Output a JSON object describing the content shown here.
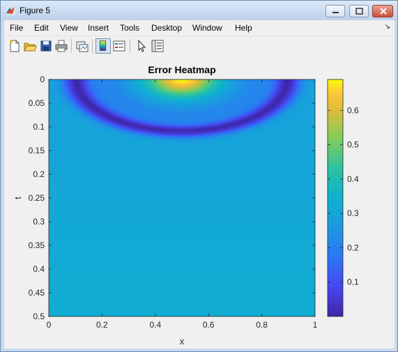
{
  "window": {
    "title": "Figure 5"
  },
  "menu": [
    "File",
    "Edit",
    "View",
    "Insert",
    "Tools",
    "Desktop",
    "Window",
    "Help"
  ],
  "toolbar_icons": [
    "new-figure-icon",
    "open-icon",
    "save-icon",
    "print-icon",
    "link-plot-icon",
    "colorbar-icon",
    "legend-icon",
    "pointer-icon",
    "property-inspector-icon"
  ],
  "chart_data": {
    "type": "heatmap",
    "title": "Error Heatmap",
    "xlabel": "x",
    "ylabel": "t",
    "xlim": [
      0,
      1
    ],
    "ylim": [
      0,
      0.5
    ],
    "y_reversed": true,
    "x_ticks": [
      "0",
      "0.2",
      "0.4",
      "0.6",
      "0.8",
      "1"
    ],
    "y_ticks": [
      "0",
      "0.05",
      "0.1",
      "0.15",
      "0.2",
      "0.25",
      "0.3",
      "0.35",
      "0.4",
      "0.45",
      "0.5"
    ],
    "colorbar": {
      "range": [
        0,
        0.69
      ],
      "ticks": [
        "0.1",
        "0.2",
        "0.3",
        "0.4",
        "0.5",
        "0.6"
      ],
      "colormap": "parula"
    },
    "description_values": {
      "peak_value": 0.69,
      "peak_location": {
        "x": 0.5,
        "t": 0.0
      },
      "min_ring": {
        "x_range": [
          0.1,
          0.9
        ],
        "t_at_center": 0.11,
        "value": 0.02
      },
      "background_level_top": 0.29,
      "background_level_bottom": 0.33
    }
  }
}
